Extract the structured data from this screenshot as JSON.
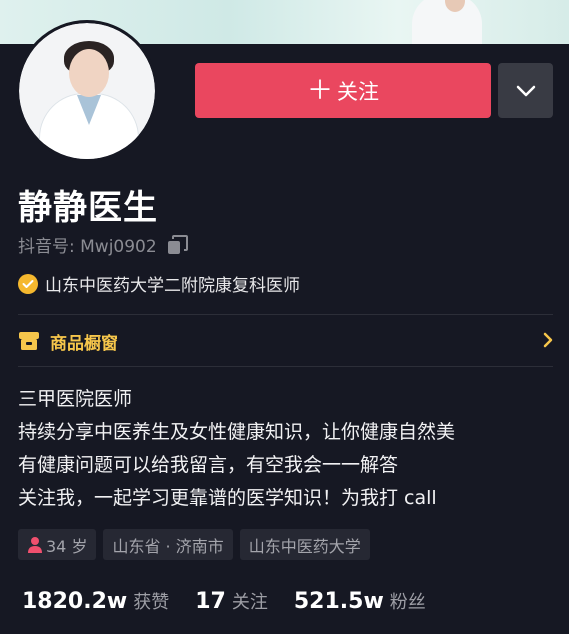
{
  "profile": {
    "name": "静静医生",
    "douyin_id": "抖音号: Mwj0902",
    "verification": "山东中医药大学二附院康复科医师"
  },
  "actions": {
    "follow_label": "关注",
    "follow_icon": "plus-icon",
    "more_icon": "chevron-down-icon"
  },
  "shop": {
    "label": "商品橱窗",
    "icon": "shop-icon"
  },
  "bio": [
    "三甲医院医师",
    "持续分享中医养生及女性健康知识，让你健康自然美",
    "有健康问题可以给我留言，有空我会一一解答",
    "关注我，一起学习更靠谱的医学知识！为我打 call"
  ],
  "tags": {
    "age": "34 岁",
    "location": "山东省 · 济南市",
    "school": "山东中医药大学"
  },
  "stats": {
    "likes": {
      "value": "1820.2w",
      "label": "获赞"
    },
    "following": {
      "value": "17",
      "label": "关注"
    },
    "followers": {
      "value": "521.5w",
      "label": "粉丝"
    }
  },
  "colors": {
    "background": "#161823",
    "follow_button": "#ea475f",
    "shop_accent": "#f6c64b",
    "verify_badge": "#f5b82e",
    "female_icon": "#f0506e"
  }
}
